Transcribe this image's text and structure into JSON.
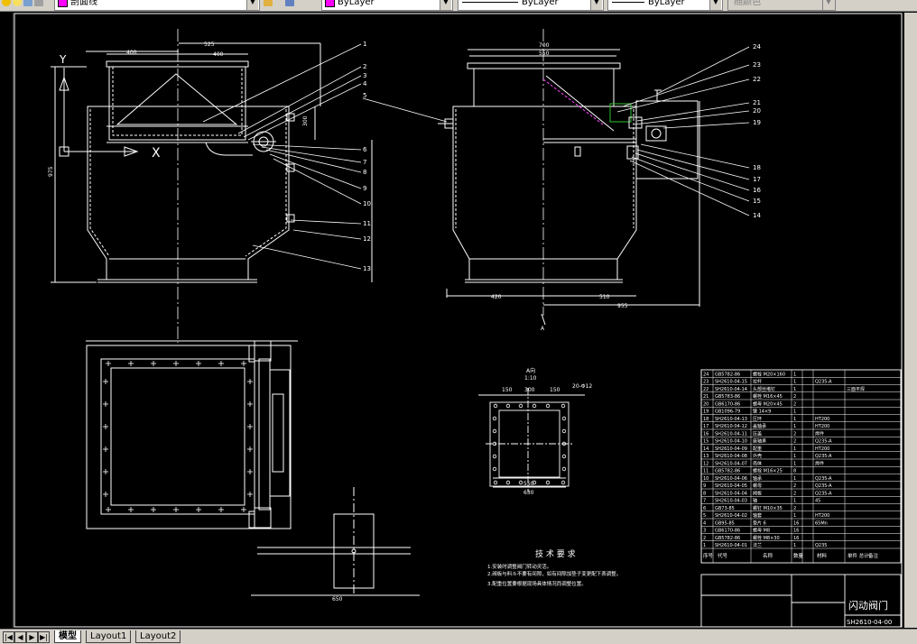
{
  "toolbar": {
    "layer_name": "剖面线",
    "color_value": "ByLayer",
    "linetype_value": "ByLayer",
    "lineweight_value": "ByLayer",
    "plotstyle_value": "随颜色"
  },
  "tabs": [
    {
      "label": "模型",
      "active": true
    },
    {
      "label": "Layout1",
      "active": false
    },
    {
      "label": "Layout2",
      "active": false
    }
  ],
  "drawing": {
    "front_dims": {
      "d400a": "400",
      "d525": "525",
      "d400b": "400",
      "d300": "300",
      "d975": "975"
    },
    "side_dims": {
      "d700": "700",
      "d550": "550",
      "d420": "420",
      "d510": "510",
      "d955": "955"
    },
    "plan_dims": {
      "d650": "650"
    },
    "section_label": "A",
    "flange": {
      "title": "A向",
      "scale": "1:10",
      "d150a": "150",
      "d300": "300",
      "d150b": "150",
      "holes": "20-Φ12",
      "d550": "550",
      "d630": "630"
    },
    "balloons_front": [
      "1",
      "2",
      "3",
      "4",
      "5",
      "6",
      "7",
      "8",
      "9",
      "10",
      "11",
      "12",
      "13"
    ],
    "balloons_side": [
      "24",
      "23",
      "22",
      "21",
      "20",
      "19",
      "18",
      "17",
      "16",
      "15",
      "14"
    ],
    "tech_title": "技 术 要 求",
    "tech_notes": [
      "1.安装时调整阀门转动灵活。",
      "2.阀板与料斗不要有间隙，如有间隙加垫子变更配下表调整。",
      "3.配重位置要根据现场具体情况而调整位置。"
    ],
    "parts": [
      [
        "24",
        "GB5782-86",
        "螺栓 M20×160",
        "1",
        "",
        ""
      ],
      [
        "23",
        "SH2610-04-15",
        "拉杆",
        "1",
        "Q235-A",
        ""
      ],
      [
        "22",
        "SH2610-04-14",
        "头部丝堵钉",
        "1",
        "",
        "三面平焊"
      ],
      [
        "21",
        "GB5783-86",
        "螺栓 M16×45",
        "2",
        "",
        ""
      ],
      [
        "20",
        "GB6170-86",
        "螺母 M20×45",
        "2",
        "",
        ""
      ],
      [
        "19",
        "GB1096-79",
        "键 14×9",
        "1",
        "",
        ""
      ],
      [
        "18",
        "SH2610-04-13",
        "压环",
        "1",
        "HT200",
        ""
      ],
      [
        "17",
        "SH2610-04-12",
        "盖轴承",
        "1",
        "HT200",
        ""
      ],
      [
        "16",
        "SH2610-04-11",
        "压盖",
        "2",
        "焊件",
        ""
      ],
      [
        "15",
        "SH2610-04-10",
        "座轴承",
        "2",
        "Q235-A",
        ""
      ],
      [
        "14",
        "SH2610-04-09",
        "配重",
        "1",
        "HT200",
        ""
      ],
      [
        "13",
        "SH2610-04-08",
        "外壳",
        "1",
        "Q235-A",
        ""
      ],
      [
        "12",
        "SH2610-04-07",
        "壳体",
        "1",
        "焊件",
        ""
      ],
      [
        "11",
        "GB5782-86",
        "螺栓 M16×25",
        "8",
        "",
        ""
      ],
      [
        "10",
        "SH2610-04-06",
        "轴承",
        "1",
        "Q235-A",
        ""
      ],
      [
        "9",
        "SH2610-04-05",
        "螺母",
        "2",
        "Q235-A",
        ""
      ],
      [
        "8",
        "SH2610-04-04",
        "阀板",
        "2",
        "Q235-A",
        ""
      ],
      [
        "7",
        "SH2610-04-03",
        "轴",
        "1",
        "45",
        ""
      ],
      [
        "6",
        "GB73-85",
        "螺钉 M10×35",
        "2",
        "",
        ""
      ],
      [
        "5",
        "SH2610-04-02",
        "轴套",
        "1",
        "HT200",
        ""
      ],
      [
        "4",
        "GB95-85",
        "垫片 6",
        "16",
        "65Mn",
        ""
      ],
      [
        "3",
        "GB6170-86",
        "螺母 M8",
        "16",
        "",
        ""
      ],
      [
        "2",
        "GB5782-86",
        "螺栓 M8×30",
        "16",
        "",
        ""
      ],
      [
        "1",
        "SH2610-04-01",
        "法兰",
        "1",
        "Q235",
        ""
      ]
    ],
    "parts_header": [
      "序号",
      "代号",
      "名称",
      "数量",
      "材料",
      "单件 总计",
      "备注"
    ],
    "title_name": "闪动阀门",
    "drawing_no": "SH2610-04-00"
  }
}
